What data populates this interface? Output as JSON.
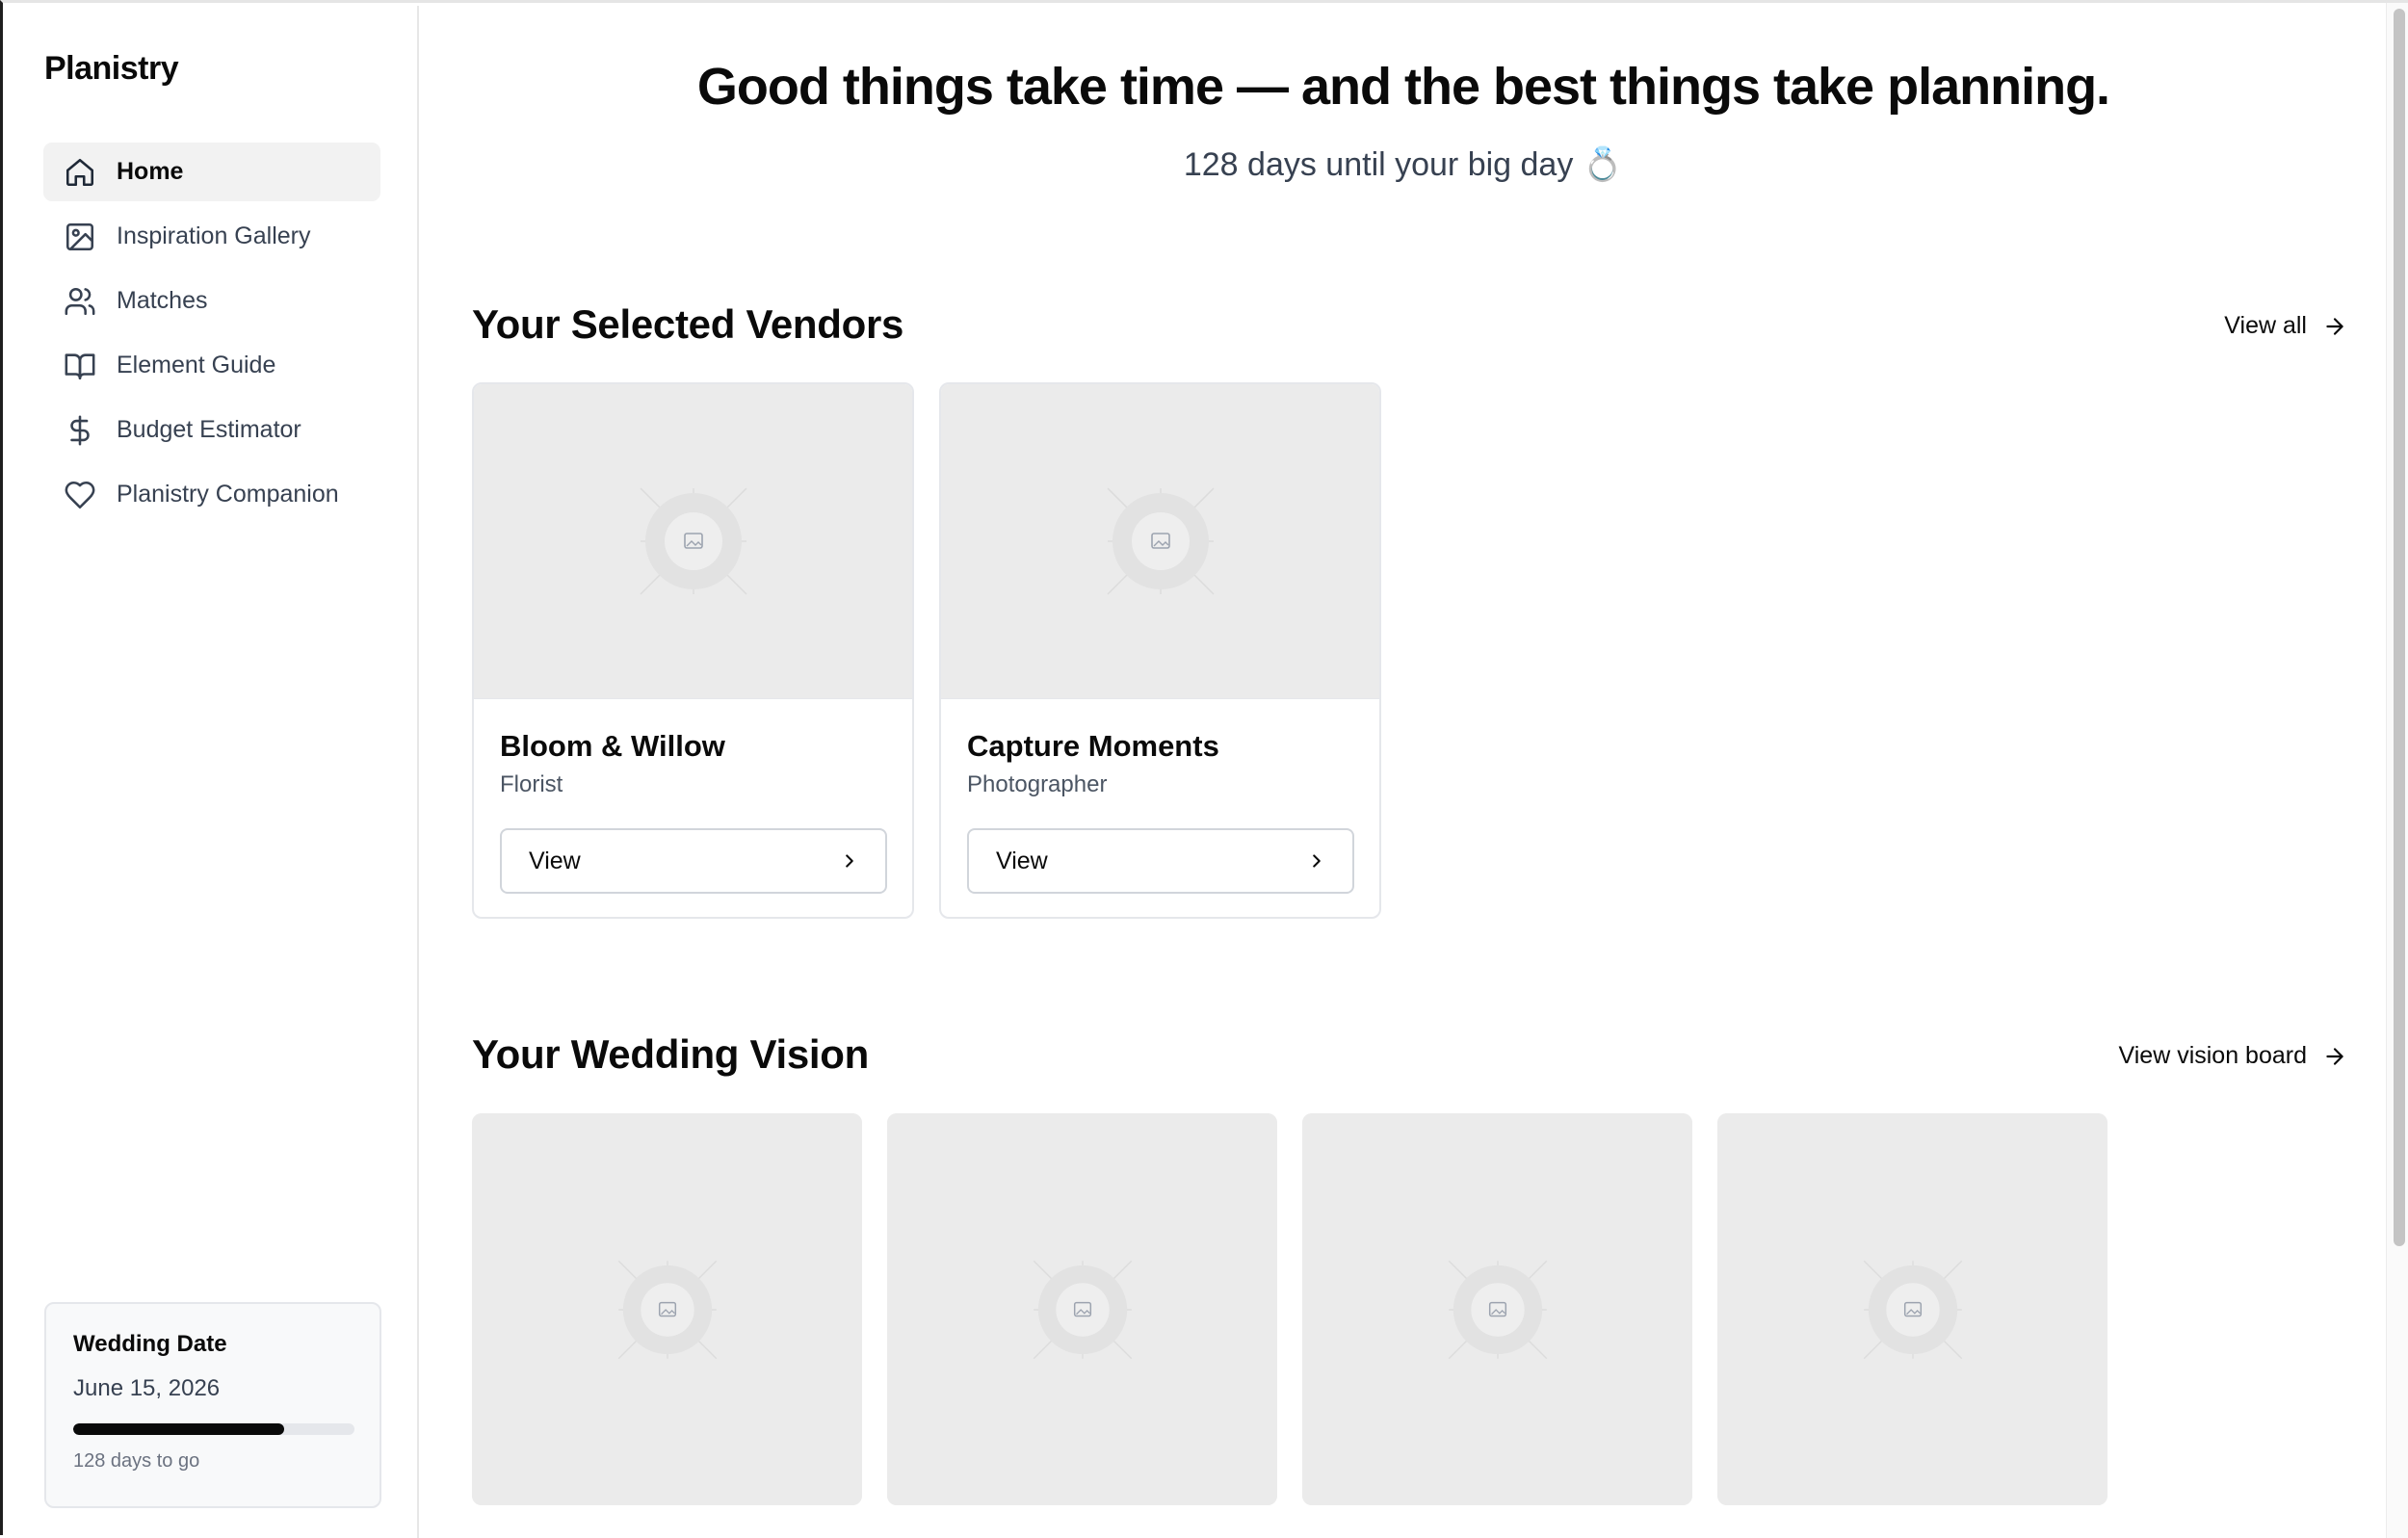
{
  "app": {
    "brand": "Planistry"
  },
  "sidebar": {
    "items": [
      {
        "label": "Home",
        "icon": "home-icon",
        "active": true
      },
      {
        "label": "Inspiration Gallery",
        "icon": "image-icon",
        "active": false
      },
      {
        "label": "Matches",
        "icon": "users-icon",
        "active": false
      },
      {
        "label": "Element Guide",
        "icon": "book-open-icon",
        "active": false
      },
      {
        "label": "Budget Estimator",
        "icon": "dollar-icon",
        "active": false
      },
      {
        "label": "Planistry Companion",
        "icon": "heart-icon",
        "active": false
      }
    ],
    "date_card": {
      "title": "Wedding Date",
      "date": "June 15, 2026",
      "progress_fraction": 0.75,
      "countdown": "128 days to go"
    }
  },
  "hero": {
    "title": "Good things take time — and the best things take planning.",
    "subtitle": "128 days until your big day 💍"
  },
  "vendors": {
    "title": "Your Selected Vendors",
    "view_all_label": "View all",
    "items": [
      {
        "name": "Bloom & Willow",
        "type": "Florist",
        "button_label": "View"
      },
      {
        "name": "Capture Moments",
        "type": "Photographer",
        "button_label": "View"
      }
    ]
  },
  "vision": {
    "title": "Your Wedding Vision",
    "link_label": "View vision board",
    "tile_count_visible": 4
  },
  "colors": {
    "accent": "#0a0a0a",
    "active_nav_bg": "#f2f2f2",
    "placeholder_bg": "#ebebeb",
    "muted_text": "#4b5563"
  }
}
